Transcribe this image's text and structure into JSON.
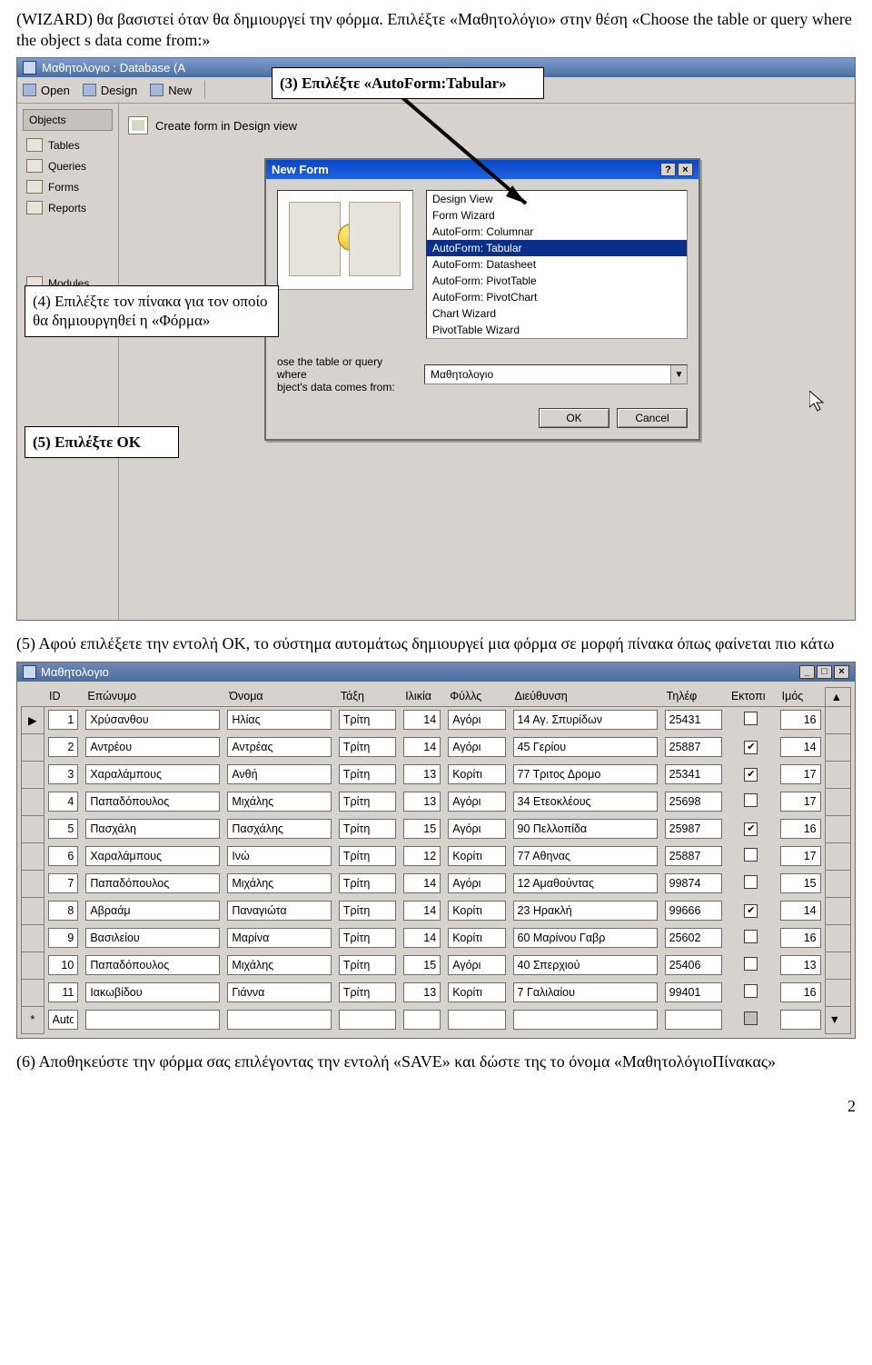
{
  "para1": "(WIZARD) θα βασιστεί όταν θα δημιουργεί την φόρμα. Επιλέξτε «Μαθητολόγιο» στην θέση «Choose the table or query where the object s data come from:»",
  "callouts": {
    "c3": "(3) Επιλέξτε «AutoForm:Tabular»",
    "c4": "(4) Επιλέξτε τον πίνακα για τον οποίο θα δημιουργηθεί η «Φόρμα»",
    "c5": "(5) Επιλέξτε ΟΚ"
  },
  "f1": {
    "title": "Μαθητολογιο : Database (A",
    "toolbar": {
      "open": "Open",
      "design": "Design",
      "new": "New"
    },
    "sidebar": {
      "group1": "Objects",
      "items": [
        "Tables",
        "Queries",
        "Forms",
        "Reports"
      ],
      "group2": "Modules"
    },
    "create_design": "Create form in Design view",
    "dlg": {
      "title": "New Form",
      "help": "?",
      "close": "×",
      "options": [
        "Design View",
        "Form Wizard",
        "AutoForm: Columnar",
        "AutoForm: Tabular",
        "AutoForm: Datasheet",
        "AutoForm: PivotTable",
        "AutoForm: PivotChart",
        "Chart Wizard",
        "PivotTable Wizard"
      ],
      "selected_index": 3,
      "bottom_label": "ose the table or query where\nbject's data comes from:",
      "combo_value": "Μαθητολογιο",
      "ok": "OK",
      "cancel": "Cancel"
    }
  },
  "para2": "(5) Αφού επιλέξετε την εντολή ΟΚ, το σύστημα αυτομάτως δημιουργεί μια φόρμα σε μορφή πίνακα όπως φαίνεται πιο κάτω",
  "f2": {
    "title": "Μαθητολογιο",
    "headers": [
      "ID",
      "Επώνυμο",
      "Όνομα",
      "Τάξη",
      "Ιλικία",
      "Φύλλς",
      "Διεύθυνση",
      "Τηλέφ",
      "Εκτοπι",
      "Ιμός"
    ],
    "rows": [
      {
        "sel": "▶",
        "id": "1",
        "ep": "Χρύσανθου",
        "on": "Ηλίας",
        "tx": "Τρίτη",
        "hl": "14",
        "fy": "Αγόρι",
        "di": "14 Αγ. Σπυρίδων",
        "tl": "25431",
        "ek": false,
        "im": "16"
      },
      {
        "sel": "",
        "id": "2",
        "ep": "Αντρέου",
        "on": "Αντρέας",
        "tx": "Τρίτη",
        "hl": "14",
        "fy": "Αγόρι",
        "di": "45 Γερίου",
        "tl": "25887",
        "ek": true,
        "im": "14"
      },
      {
        "sel": "",
        "id": "3",
        "ep": "Χαραλάμπους",
        "on": "Ανθή",
        "tx": "Τρίτη",
        "hl": "13",
        "fy": "Κορίτι",
        "di": "77 Τριτος Δρομο",
        "tl": "25341",
        "ek": true,
        "im": "17"
      },
      {
        "sel": "",
        "id": "4",
        "ep": "Παπαδόπουλος",
        "on": "Μιχάλης",
        "tx": "Τρίτη",
        "hl": "13",
        "fy": "Αγόρι",
        "di": "34 Ετεοκλέους",
        "tl": "25698",
        "ek": false,
        "im": "17"
      },
      {
        "sel": "",
        "id": "5",
        "ep": "Πασχάλη",
        "on": "Πασχάλης",
        "tx": "Τρίτη",
        "hl": "15",
        "fy": "Αγόρι",
        "di": "90 Πελλοπίδα",
        "tl": "25987",
        "ek": true,
        "im": "16"
      },
      {
        "sel": "",
        "id": "6",
        "ep": "Χαραλάμπους",
        "on": "Ινώ",
        "tx": "Τρίτη",
        "hl": "12",
        "fy": "Κορίτι",
        "di": "77 Αθηνας",
        "tl": "25887",
        "ek": false,
        "im": "17"
      },
      {
        "sel": "",
        "id": "7",
        "ep": "Παπαδόπουλος",
        "on": "Μιχάλης",
        "tx": "Τρίτη",
        "hl": "14",
        "fy": "Αγόρι",
        "di": "12 Αμαθούντας",
        "tl": "99874",
        "ek": false,
        "im": "15"
      },
      {
        "sel": "",
        "id": "8",
        "ep": "Αβραάμ",
        "on": "Παναγιώτα",
        "tx": "Τρίτη",
        "hl": "14",
        "fy": "Κορίτι",
        "di": "23 Ηρακλή",
        "tl": "99666",
        "ek": true,
        "im": "14"
      },
      {
        "sel": "",
        "id": "9",
        "ep": "Βασιλείου",
        "on": "Μαρίνα",
        "tx": "Τρίτη",
        "hl": "14",
        "fy": "Κορίτι",
        "di": "60 Μαρίνου Γαβρ",
        "tl": "25602",
        "ek": false,
        "im": "16"
      },
      {
        "sel": "",
        "id": "10",
        "ep": "Παπαδόπουλος",
        "on": "Μιχάλης",
        "tx": "Τρίτη",
        "hl": "15",
        "fy": "Αγόρι",
        "di": "40 Σπερχιού",
        "tl": "25406",
        "ek": false,
        "im": "13"
      },
      {
        "sel": "",
        "id": "11",
        "ep": "Ιακωβίδου",
        "on": "Γιάννα",
        "tx": "Τρίτη",
        "hl": "13",
        "fy": "Κορίτι",
        "di": "7 Γαλιλαίου",
        "tl": "99401",
        "ek": false,
        "im": "16"
      }
    ],
    "newrow": {
      "sel": "*",
      "id": "AutoNumber)"
    }
  },
  "para3": "(6) Αποθηκεύστε την φόρμα σας επιλέγοντας την εντολή «SAVE» και δώστε της το όνομα «ΜαθητολόγιοΠίνακας»",
  "page_num": "2"
}
